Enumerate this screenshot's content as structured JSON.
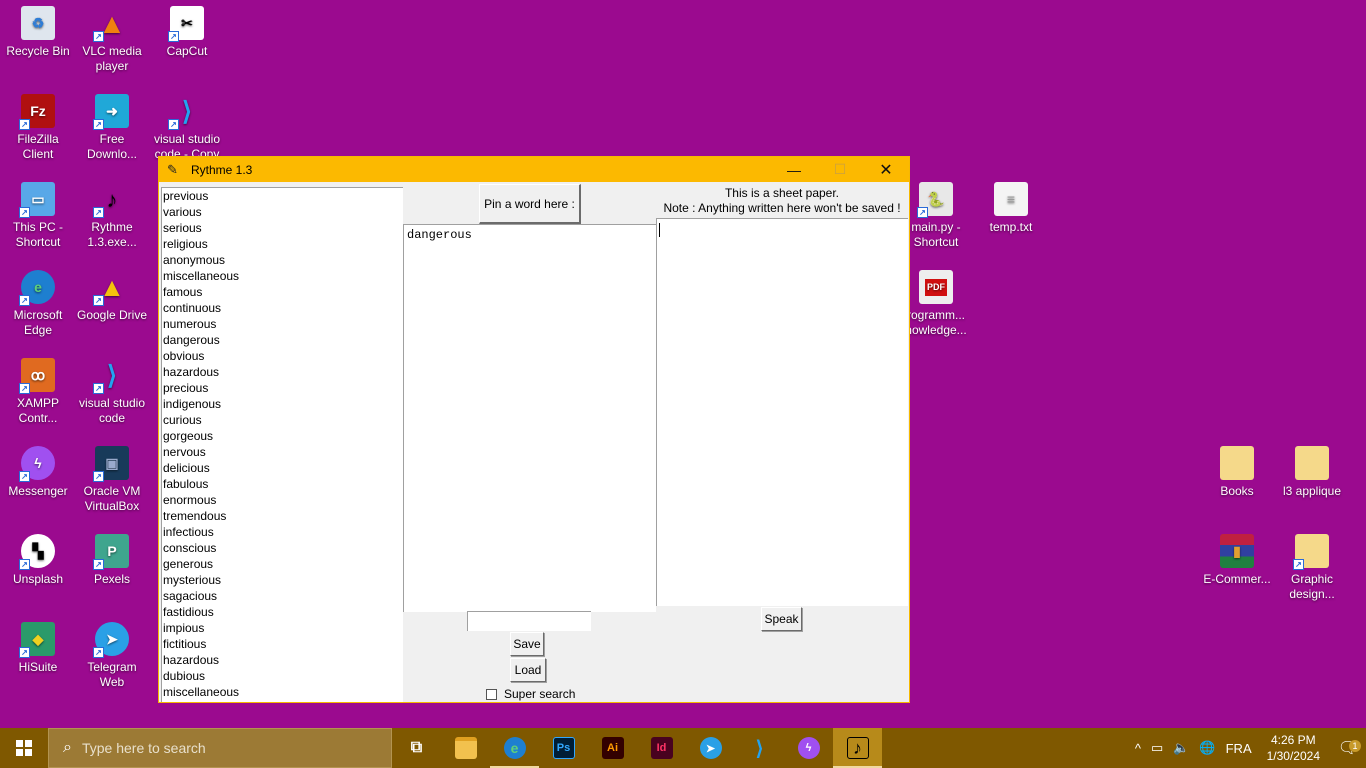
{
  "desktop": {
    "background_color": "#9b0a8f",
    "icons": [
      {
        "label": "Recycle Bin",
        "icon": "recycle-bin-icon"
      },
      {
        "label": "VLC media player",
        "icon": "vlc-icon"
      },
      {
        "label": "CapCut",
        "icon": "capcut-icon"
      },
      {
        "label": "FileZilla Client",
        "icon": "filezilla-icon"
      },
      {
        "label": "Free Downlo...",
        "icon": "free-download-manager-icon"
      },
      {
        "label": "visual studio code - Copy",
        "icon": "vscode-icon"
      },
      {
        "label": "This PC - Shortcut",
        "icon": "this-pc-icon"
      },
      {
        "label": "Rythme 1.3.exe...",
        "icon": "rythme-icon"
      },
      {
        "label": "Microsoft Edge",
        "icon": "edge-icon"
      },
      {
        "label": "Google Drive",
        "icon": "google-drive-icon"
      },
      {
        "label": "XAMPP Contr...",
        "icon": "xampp-icon"
      },
      {
        "label": "visual studio code",
        "icon": "vscode-icon"
      },
      {
        "label": "Messenger",
        "icon": "messenger-icon"
      },
      {
        "label": "Oracle VM VirtualBox",
        "icon": "virtualbox-icon"
      },
      {
        "label": "Unsplash",
        "icon": "unsplash-icon"
      },
      {
        "label": "Pexels",
        "icon": "pexels-icon"
      },
      {
        "label": "HiSuite",
        "icon": "hisuite-icon"
      },
      {
        "label": "Telegram Web",
        "icon": "telegram-icon"
      },
      {
        "label": "main.py - Shortcut",
        "icon": "python-file-icon"
      },
      {
        "label": "temp.txt",
        "icon": "text-file-icon"
      },
      {
        "label": "rogramm... nowledge...",
        "icon": "pdf-file-icon"
      },
      {
        "label": "Books",
        "icon": "folder-icon"
      },
      {
        "label": "l3 applique",
        "icon": "folder-icon"
      },
      {
        "label": "E-Commer...",
        "icon": "winrar-archive-icon"
      },
      {
        "label": "Graphic design...",
        "icon": "folder-shortcut-icon"
      }
    ]
  },
  "window": {
    "title": "Rythme 1.3",
    "accent_color": "#fcb900",
    "controls": {
      "minimize": "—",
      "maximize": "☐",
      "close": "✕"
    },
    "word_list": [
      "previous",
      "various",
      "serious",
      "religious",
      "anonymous",
      "miscellaneous",
      "famous",
      "continuous",
      "numerous",
      "dangerous",
      "obvious",
      "hazardous",
      "precious",
      "indigenous",
      "curious",
      "gorgeous",
      "nervous",
      "delicious",
      "fabulous",
      "enormous",
      "tremendous",
      "infectious",
      "conscious",
      "generous",
      "mysterious",
      "sagacious",
      "fastidious",
      "impious",
      "fictitious",
      "hazardous",
      "dubious",
      "miscellaneous"
    ],
    "pin_button_label": "Pin a word here :",
    "pinned_text": "dangerous",
    "sheet_note_line1": "This is a sheet paper.",
    "sheet_note_line2": "Note : Anything written here won't be saved !",
    "sheet_text": "",
    "filename_value": "",
    "save_label": "Save",
    "load_label": "Load",
    "speak_label": "Speak",
    "super_search_label": "Super search",
    "super_search_checked": false
  },
  "taskbar": {
    "search_placeholder": "Type here to search",
    "pinned_apps": [
      {
        "name": "task-view",
        "glyph": "⧉"
      },
      {
        "name": "file-explorer",
        "glyph": "▬"
      },
      {
        "name": "edge",
        "glyph": "e"
      },
      {
        "name": "photoshop",
        "glyph": "Ps"
      },
      {
        "name": "illustrator",
        "glyph": "Ai"
      },
      {
        "name": "indesign",
        "glyph": "Id"
      },
      {
        "name": "telegram",
        "glyph": "➤"
      },
      {
        "name": "vscode",
        "glyph": "⟩"
      },
      {
        "name": "messenger",
        "glyph": "ϟ"
      },
      {
        "name": "rythme",
        "glyph": "♪"
      }
    ],
    "tray": {
      "chevron": "^",
      "battery": "▭",
      "volume": "🔈",
      "network": "🌐",
      "language": "FRA",
      "time": "4:26 PM",
      "date": "1/30/2024",
      "notification_count": "1"
    }
  }
}
